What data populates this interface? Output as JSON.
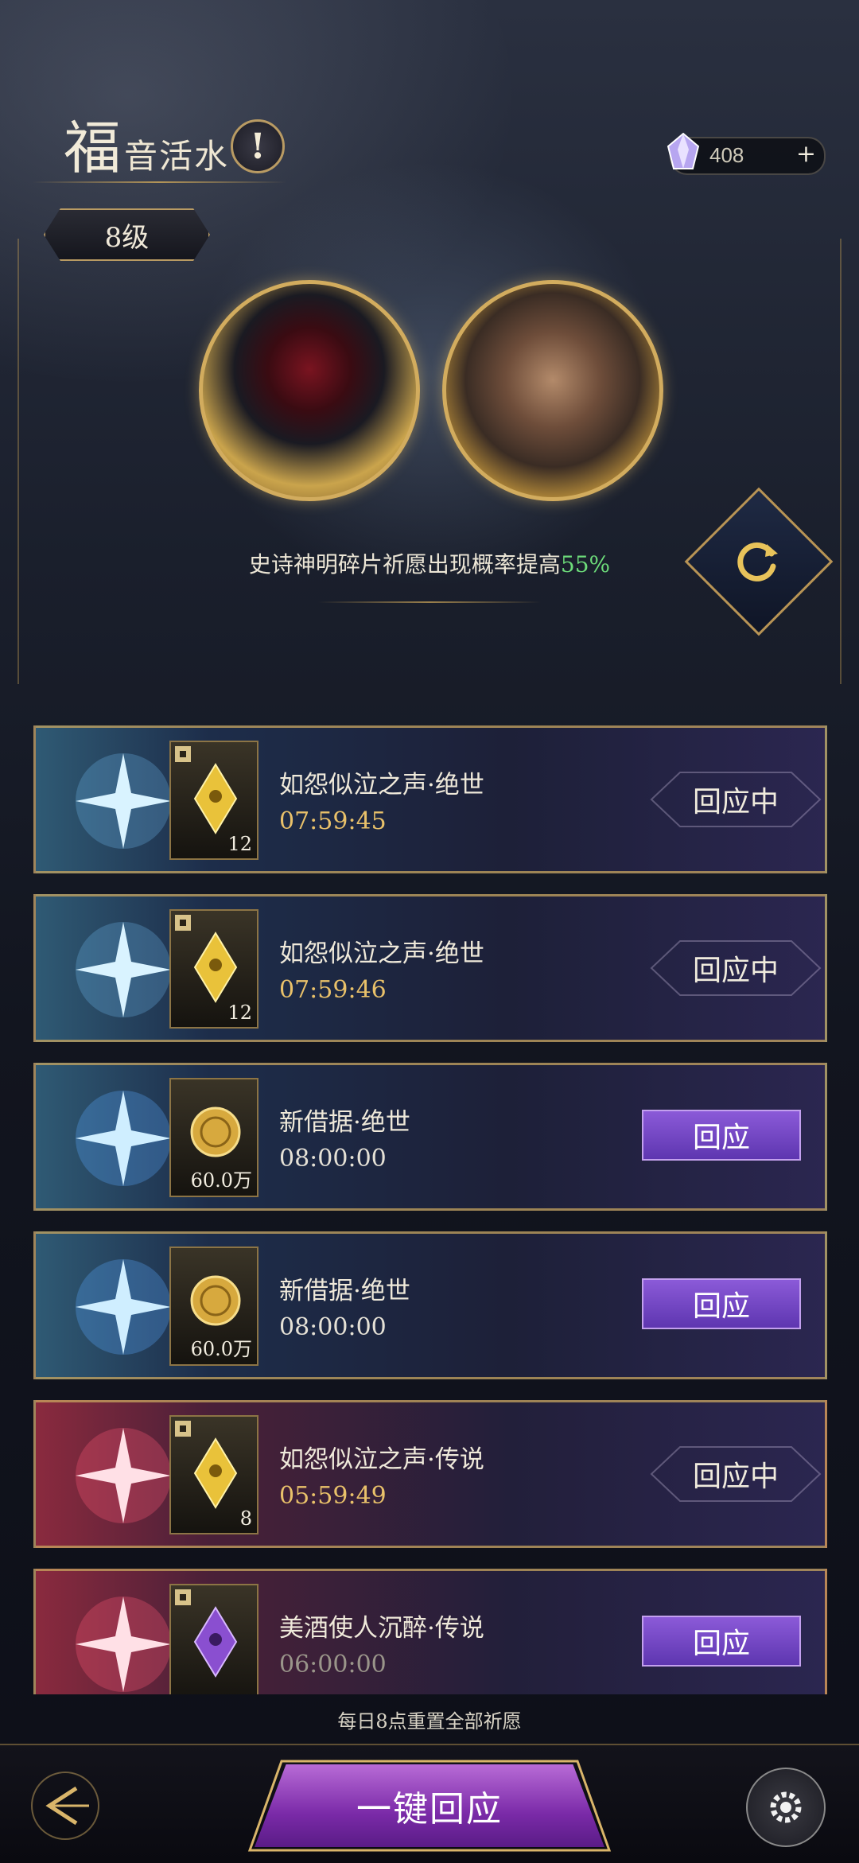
{
  "header": {
    "title_first": "福",
    "title_rest": "音活水",
    "info_glyph": "!",
    "level": "8级",
    "currency_amount": "408",
    "currency_plus": "+"
  },
  "banner": {
    "description_prefix": "史诗神明碎片祈愿出现概率提高",
    "description_percent": "55%"
  },
  "wishes": [
    {
      "name": "如怨似泣之声·绝世",
      "timer": "07:59:45",
      "count": "12",
      "status": "回应中",
      "theme": "blue",
      "item": "gold-gem"
    },
    {
      "name": "如怨似泣之声·绝世",
      "timer": "07:59:46",
      "count": "12",
      "status": "回应中",
      "theme": "blue",
      "item": "gold-gem"
    },
    {
      "name": "新借据·绝世",
      "timer": "08:00:00",
      "count": "60.0万",
      "status": "回应",
      "theme": "blue",
      "item": "coin"
    },
    {
      "name": "新借据·绝世",
      "timer": "08:00:00",
      "count": "60.0万",
      "status": "回应",
      "theme": "blue",
      "item": "coin"
    },
    {
      "name": "如怨似泣之声·传说",
      "timer": "05:59:49",
      "count": "8",
      "status": "回应中",
      "theme": "red",
      "item": "gold-gem"
    },
    {
      "name": "美酒使人沉醉·传说",
      "timer": "06:00:00",
      "count": "",
      "status": "回应",
      "theme": "red",
      "item": "purple-gem"
    }
  ],
  "footer": {
    "reset_note": "每日8点重置全部祈愿",
    "one_key_label": "一键回应"
  },
  "colors": {
    "gold_timer": "#e9c16a",
    "percent_green": "#6ddc7a",
    "respond_purple": "#7a46c8",
    "frame_gold": "#c8a55f"
  }
}
